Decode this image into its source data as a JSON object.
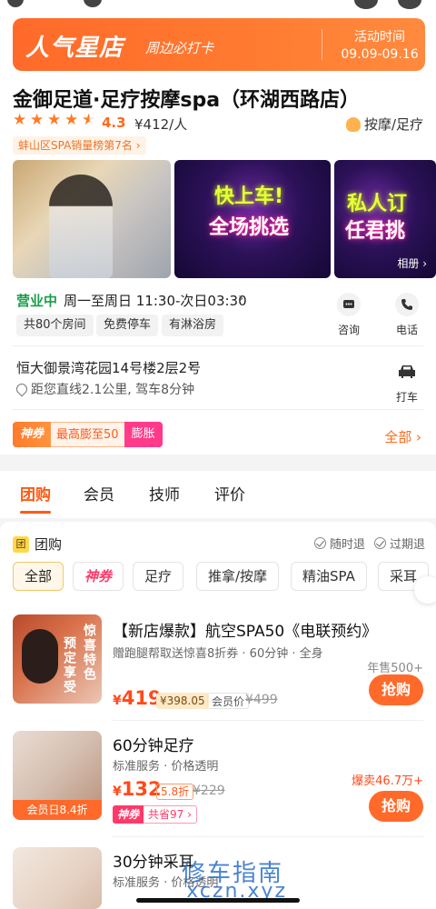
{
  "banner": {
    "title": "人气星店",
    "subtitle": "周边必打卡",
    "activity_label": "活动时间",
    "activity_dates": "09.09-09.16"
  },
  "shop": {
    "name": "金御足道·足疗按摩spa（环湖西路店）",
    "rating": "4.3",
    "stars": 4.5,
    "price": "¥412/人",
    "category": "按摩/足疗",
    "rank": "蚌山区SPA销量榜第7名",
    "photos": {
      "p2_line1": "快上车!",
      "p2_line2": "全场挑选",
      "p3_line1": "私人订",
      "p3_line2": "任君挑",
      "album_label": "相册 ›"
    },
    "status": "营业中",
    "hours": "周一至周日 11:30-次日03:30",
    "facilities": [
      "共80个房间",
      "免费停车",
      "有淋浴房"
    ],
    "consult_label": "咨询",
    "phone_label": "电话",
    "address": "恒大御景湾花园14号楼2层2号",
    "distance": "距您直线2.1公里, 驾车8分钟",
    "taxi_label": "打车",
    "promo": {
      "tag": "神券",
      "text": "最高膨至50",
      "badge": "膨胀"
    },
    "all_label": "全部 ›"
  },
  "tabs": [
    {
      "label": "团购"
    },
    {
      "label": "会员"
    },
    {
      "label": "技师"
    },
    {
      "label": "评价"
    }
  ],
  "group": {
    "badge": "团",
    "title": "团购",
    "refund_any": "随时退",
    "refund_expired": "过期退",
    "chips": [
      "全部",
      "神券",
      "足疗",
      "推拿/按摩",
      "精油SPA",
      "采耳"
    ]
  },
  "deals": [
    {
      "title": "【新店爆款】航空SPA50《电联预约》",
      "sub": "赠跑腿帮取送惊喜8折券 · 60分钟 · 全身",
      "price": "419",
      "vip_price": "¥398.05",
      "vip_label": "会员价",
      "orig": "¥499",
      "sold": "年售500+",
      "buy": "抢购",
      "thumb_text1": "预定享受",
      "thumb_text2": "惊喜特色"
    },
    {
      "title": "60分钟足疗",
      "sub": "标准服务 · 价格透明",
      "price": "132",
      "discount": "5.8折",
      "orig": "¥229",
      "sold": "爆卖46.7万+",
      "buy": "抢购",
      "thumb_cap": "会员日8.4折",
      "coupon_tag": "神券",
      "coupon_text": "共省97 ›"
    },
    {
      "title": "30分钟采耳",
      "sub": "标准服务 · 价格透明"
    }
  ],
  "watermark": {
    "line1": "修车指南",
    "line2": "xczn.xyz"
  }
}
